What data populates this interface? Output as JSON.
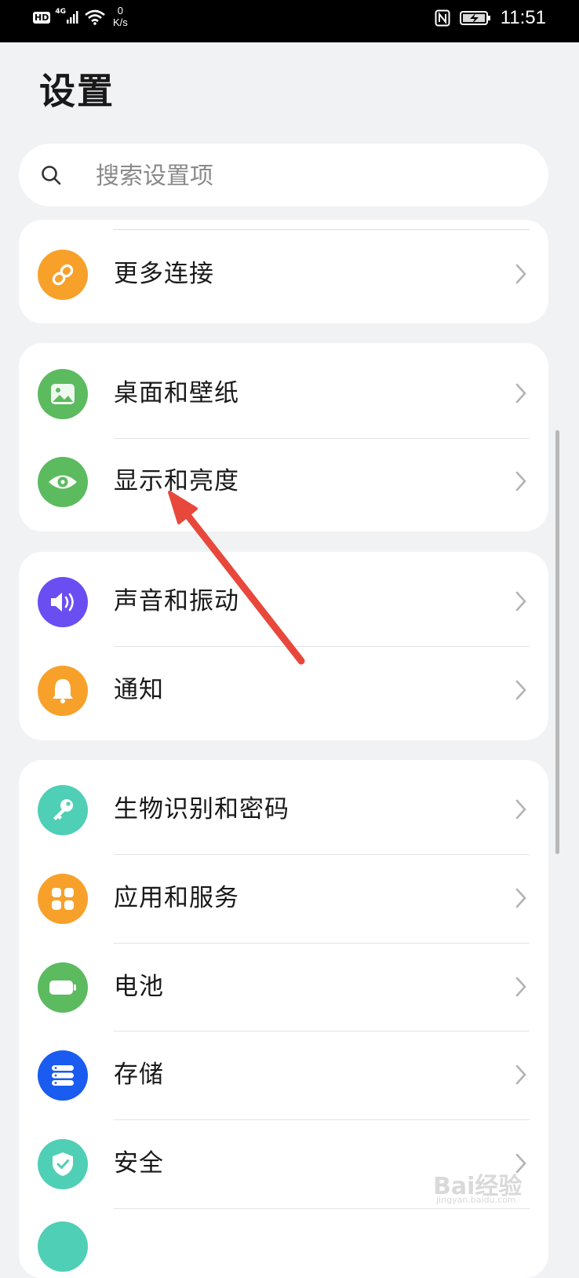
{
  "status_bar": {
    "hd": "HD",
    "network": "4G",
    "speed_value": "0",
    "speed_unit": "K/s",
    "time": "11:51"
  },
  "page_title": "设置",
  "search": {
    "placeholder": "搜索设置项"
  },
  "rows": [
    {
      "label": "更多连接",
      "icon": "link-icon",
      "color": "#f7a12a"
    },
    {
      "label": "桌面和壁纸",
      "icon": "wallpaper-image-icon",
      "color": "#5cba5f"
    },
    {
      "label": "显示和亮度",
      "icon": "eye-icon",
      "color": "#5cba5f"
    },
    {
      "label": "声音和振动",
      "icon": "speaker-icon",
      "color": "#6b4ef2"
    },
    {
      "label": "通知",
      "icon": "bell-icon",
      "color": "#f7a12a"
    },
    {
      "label": "生物识别和密码",
      "icon": "key-icon",
      "color": "#4fcfb5"
    },
    {
      "label": "应用和服务",
      "icon": "apps-grid-icon",
      "color": "#f7a12a"
    },
    {
      "label": "电池",
      "icon": "battery-icon",
      "color": "#5cba5f"
    },
    {
      "label": "存储",
      "icon": "storage-icon",
      "color": "#1a5bf0"
    },
    {
      "label": "安全",
      "icon": "shield-check-icon",
      "color": "#4fcfb5"
    }
  ],
  "annotation_arrow_color": "#e8483b",
  "watermark": {
    "brand": "Bai经验",
    "url": "jingyan.baidu.com"
  }
}
